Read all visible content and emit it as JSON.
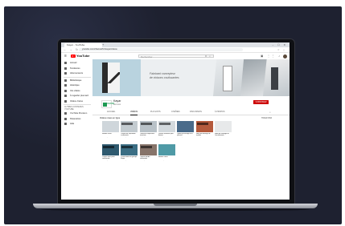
{
  "colors": {
    "background": "#1e2130",
    "youtube_red": "#ff0000",
    "subscribe_red": "#cc0000",
    "brand_green": "#1e9a53"
  },
  "browser": {
    "tab_title": "Kayar - YouTube",
    "new_tab_icon": "plus-icon",
    "url": "youtube.com/channel/UCkayar/videos"
  },
  "youtube": {
    "logo_text": "YouTube",
    "search_placeholder": "Rechercher",
    "header_icons": [
      "video-camera-icon",
      "apps-icon",
      "bell-icon"
    ]
  },
  "sidebar": {
    "items": [
      {
        "label": "Accueil",
        "icon": "home-icon"
      },
      {
        "label": "Tendances",
        "icon": "fire-icon"
      },
      {
        "label": "Abonnements",
        "icon": "subscriptions-icon"
      },
      {
        "label": "Bibliothèque",
        "icon": "library-icon"
      },
      {
        "label": "Historique",
        "icon": "history-icon"
      },
      {
        "label": "Vos vidéos",
        "icon": "play-icon"
      },
      {
        "label": "À regarder plus tard",
        "icon": "clock-icon"
      },
      {
        "label": "Vidéos J'aime",
        "icon": "thumb-up-icon"
      }
    ],
    "section_label": "AUTRES CONTENUS YOUTUBE",
    "extra_items": [
      {
        "label": "YouTube Premium",
        "icon": "youtube-icon"
      },
      {
        "label": "Paramètres",
        "icon": "gear-icon"
      },
      {
        "label": "Aide",
        "icon": "help-icon"
      }
    ]
  },
  "banner": {
    "tagline_line1": "Fabricant concepteur",
    "tagline_line2": "de cloisons coulissantes"
  },
  "channel": {
    "logo_text": "KAYAR",
    "name": "Kayar",
    "subscribers": "abonnés",
    "subscribe_label": "S'ABONNER"
  },
  "tabs": [
    "ACCUEIL",
    "VIDÉOS",
    "PLAYLISTS",
    "CHAÎNES",
    "DISCUSSION",
    "À PROPOS"
  ],
  "active_tab": "VIDÉOS",
  "section": {
    "title": "Vidéos mises en ligne",
    "sort_label": "TRIER PAR"
  },
  "videos": [
    {
      "title": "KAYAR RÉNO",
      "meta": "vues • il y a",
      "thumb": "#cfd6db",
      "caption": ""
    },
    {
      "title": "Cloison de séparation coulissante",
      "meta": "vues • il y a",
      "thumb": "#c3cbd0",
      "caption": "CLOISON"
    },
    {
      "title": "Cloison de séparation ouverture",
      "meta": "vues • il y a",
      "thumb": "#b9c2c8",
      "caption": "CLOISON"
    },
    {
      "title": "Cloison amovible pour bureau",
      "meta": "vues • il y a",
      "thumb": "#d3d9dd",
      "caption": "CLOISON"
    },
    {
      "title": "Vidéo de montage d'un placard",
      "meta": "vues • il y a",
      "thumb": "#4a6b8a",
      "caption": ""
    },
    {
      "title": "Vidéo de montage de façades",
      "meta": "vues • il y a",
      "thumb": "#b45a3c",
      "caption": "MONTAGE"
    },
    {
      "title": "Vidéo de montage de l'encadrement",
      "meta": "vues • il y a",
      "thumb": "#e7e9ea",
      "caption": ""
    },
    {
      "title": "Cloison avec porte coulissante",
      "meta": "vues • il y a",
      "thumb": "#2f5a6f",
      "caption": "KAYAR"
    },
    {
      "title": "Présentation du groupe Kayar",
      "meta": "vues • il y a",
      "thumb": "#3b6e84",
      "caption": "KAYAR"
    },
    {
      "title": "Cloison KAYAR coulissante",
      "meta": "vues • il y a",
      "thumb": "#87746a",
      "caption": "KAYAR"
    },
    {
      "title": "KAYAR RÉNO",
      "meta": "vues • il y a",
      "thumb": "#4f9aa6",
      "caption": ""
    }
  ]
}
